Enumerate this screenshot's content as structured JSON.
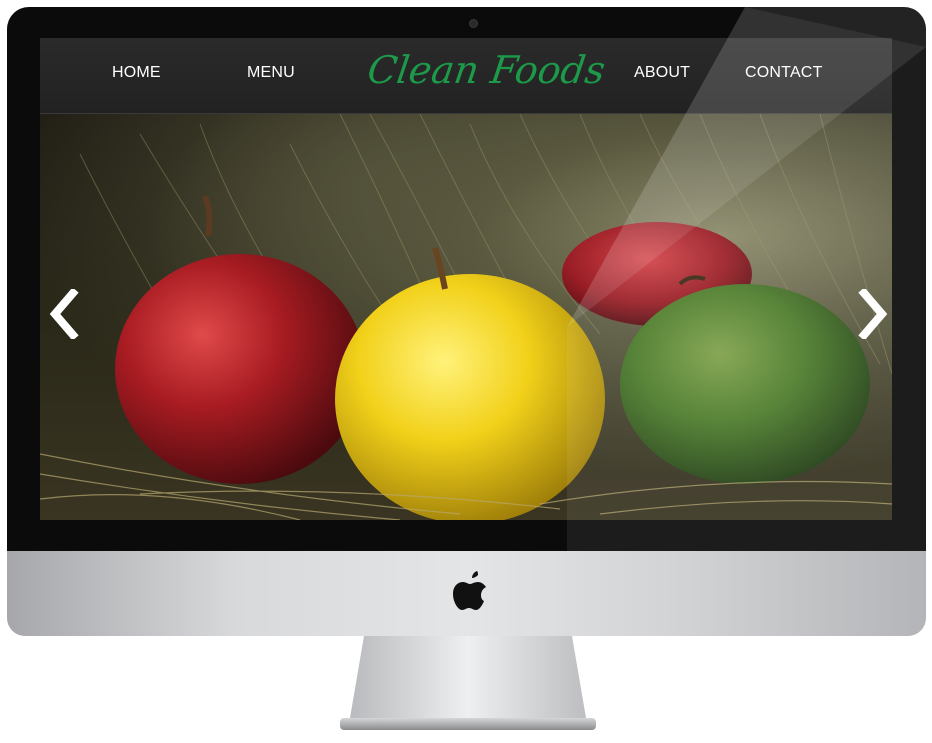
{
  "nav": {
    "home": "HOME",
    "menu": "MENU",
    "about": "ABOUT",
    "contact": "CONTACT"
  },
  "logo": {
    "text": "Clean Foods",
    "color": "#1c9a4a"
  },
  "hero": {
    "subject": "apples",
    "prev_icon": "chevron-left-icon",
    "next_icon": "chevron-right-icon"
  },
  "device": {
    "chin_icon": "apple-logo-icon"
  }
}
